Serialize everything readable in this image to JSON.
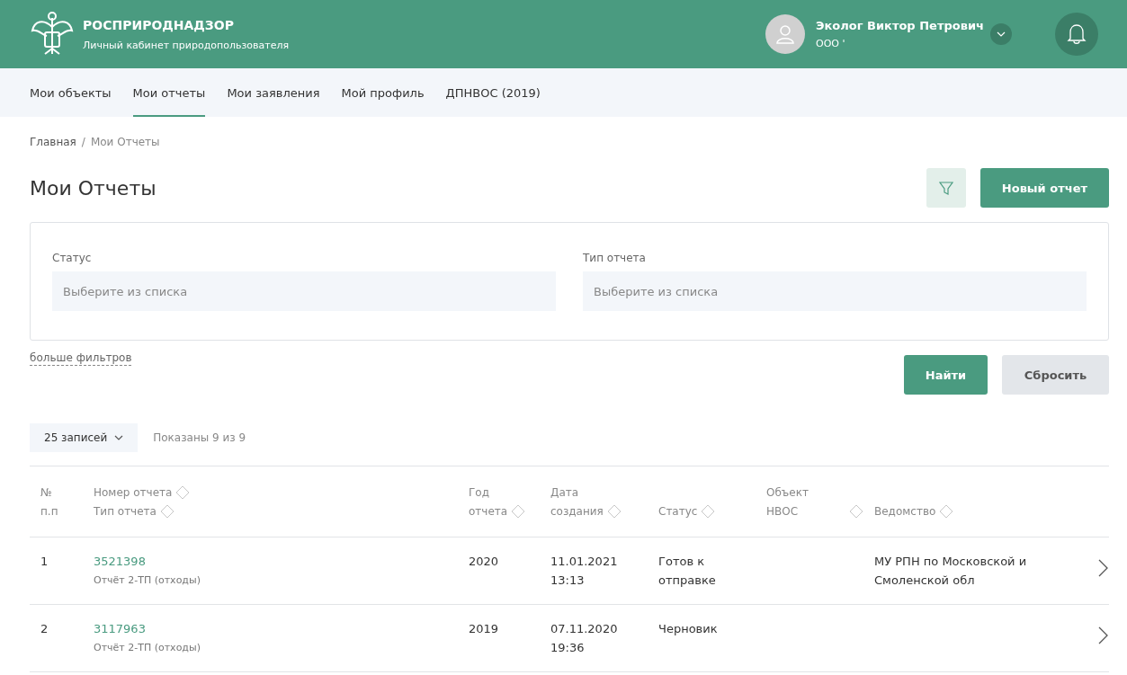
{
  "header": {
    "org_name": "РОСПРИРОДНАДЗОР",
    "subtitle": "Личный кабинет природопользователя",
    "user_name": "Эколог Виктор Петрович",
    "user_org": "ООО '"
  },
  "tabs": [
    {
      "label": "Мои объекты",
      "selected": false
    },
    {
      "label": "Мои отчеты",
      "selected": true
    },
    {
      "label": "Мои заявления",
      "selected": false
    },
    {
      "label": "Мой профиль",
      "selected": false
    },
    {
      "label": "ДПНВОС (2019)",
      "selected": false
    }
  ],
  "breadcrumb_separator": "/",
  "breadcrumbs": [
    {
      "label": "Главная",
      "current": false
    },
    {
      "label": "Мои Отчеты",
      "current": true
    }
  ],
  "page_title": "Мои Отчеты",
  "new_report_button": "Новый отчет",
  "filters": [
    {
      "label": "Статус",
      "placeholder": "Выберите из списка"
    },
    {
      "label": "Тип отчета",
      "placeholder": "Выберите из списка"
    }
  ],
  "more_filters_link": "больше фильтров",
  "search_button": "Найти",
  "reset_button": "Сбросить",
  "page_size": "25 записей",
  "shown_count": "Показаны 9 из 9",
  "table": {
    "columns": [
      {
        "lines": [
          {
            "text": "№",
            "sortable": false
          },
          {
            "text": "п.п",
            "sortable": false
          }
        ]
      },
      {
        "lines": [
          {
            "text": "Номер отчета",
            "sortable": true
          },
          {
            "text": "Тип отчета",
            "sortable": true
          }
        ]
      },
      {
        "lines": [
          {
            "text": "Год",
            "sortable": false
          },
          {
            "text": "отчета",
            "sortable": true
          }
        ]
      },
      {
        "lines": [
          {
            "text": "Дата",
            "sortable": false
          },
          {
            "text": "создания",
            "sortable": true
          }
        ]
      },
      {
        "lines": [
          {
            "text": "Статус",
            "sortable": true
          }
        ]
      },
      {
        "lines": [
          {
            "text": "Объект",
            "sortable": false
          },
          {
            "text": "НВОС",
            "sortable": true
          }
        ]
      },
      {
        "lines": [
          {
            "text": "Ведомство",
            "sortable": true
          }
        ]
      }
    ],
    "rows": [
      {
        "index": "1",
        "report_number": "3521398",
        "report_type": "Отчёт 2-ТП (отходы)",
        "year": "2020",
        "date": "11.01.2021",
        "time": "13:13",
        "status": "Готов к отправке",
        "department": "МУ РПН по Московской и Смоленской обл"
      },
      {
        "index": "2",
        "report_number": "3117963",
        "report_type": "Отчёт 2-ТП (отходы)",
        "year": "2019",
        "date": "07.11.2020",
        "time": "19:36",
        "status": "Черновик"
      }
    ]
  }
}
